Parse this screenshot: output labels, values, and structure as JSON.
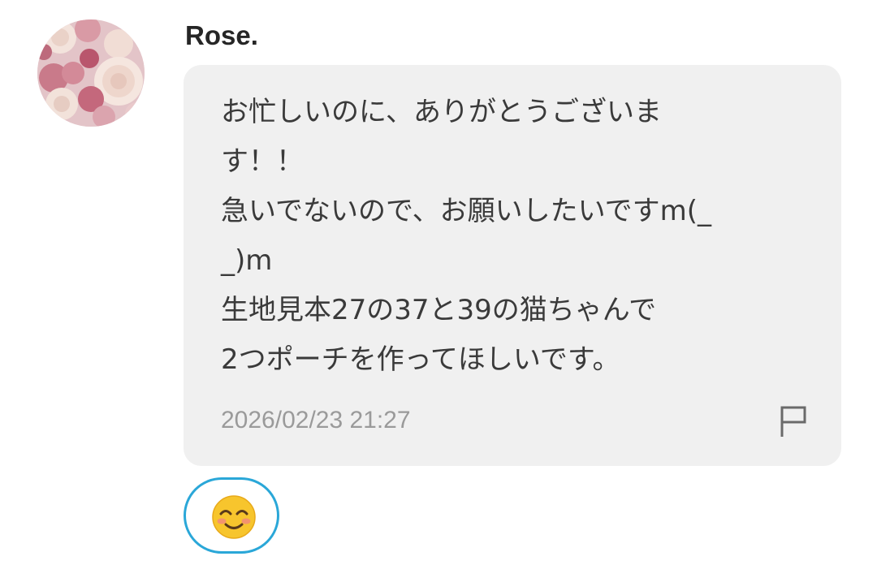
{
  "message": {
    "sender_name": "Rose.",
    "avatar_icon": "rose-flowers-avatar",
    "lines": [
      "お忙しいのに、ありがとうございま",
      "す！！",
      "急いでないので、お願いしたいですm(_",
      "_)m",
      "生地見本27の37と39の猫ちゃんで",
      "2つポーチを作ってほしいです。"
    ],
    "timestamp": "2026/02/23 21:27",
    "report_icon": "flag-icon"
  },
  "reaction": {
    "icon": "smiling-face-icon",
    "accent_color": "#2aa7d8"
  },
  "colors": {
    "bubble_bg": "#f0f0f0",
    "text": "#3a3a3a",
    "timestamp": "#9a9a9a"
  }
}
